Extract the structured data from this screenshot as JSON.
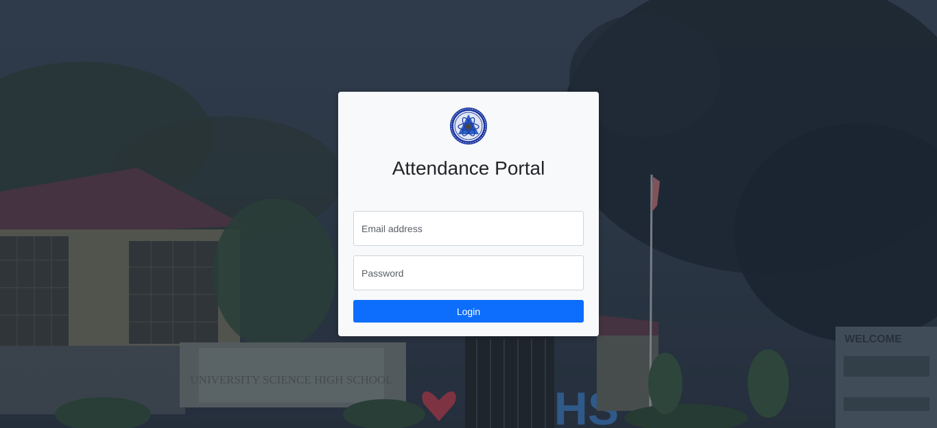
{
  "login": {
    "title": "Attendance Portal",
    "email_placeholder": "Email address",
    "password_placeholder": "Password",
    "login_label": "Login"
  },
  "background": {
    "sign_text": "UNIVERSITY SCIENCE HIGH SCHOOL",
    "welcome_text": "WELCOME",
    "letters_text": "HS"
  },
  "colors": {
    "primary": "#0d6efd",
    "card_bg": "#f8f9fa",
    "logo_blue": "#1f3aa3"
  },
  "icons": {
    "logo": "school-seal-icon"
  }
}
